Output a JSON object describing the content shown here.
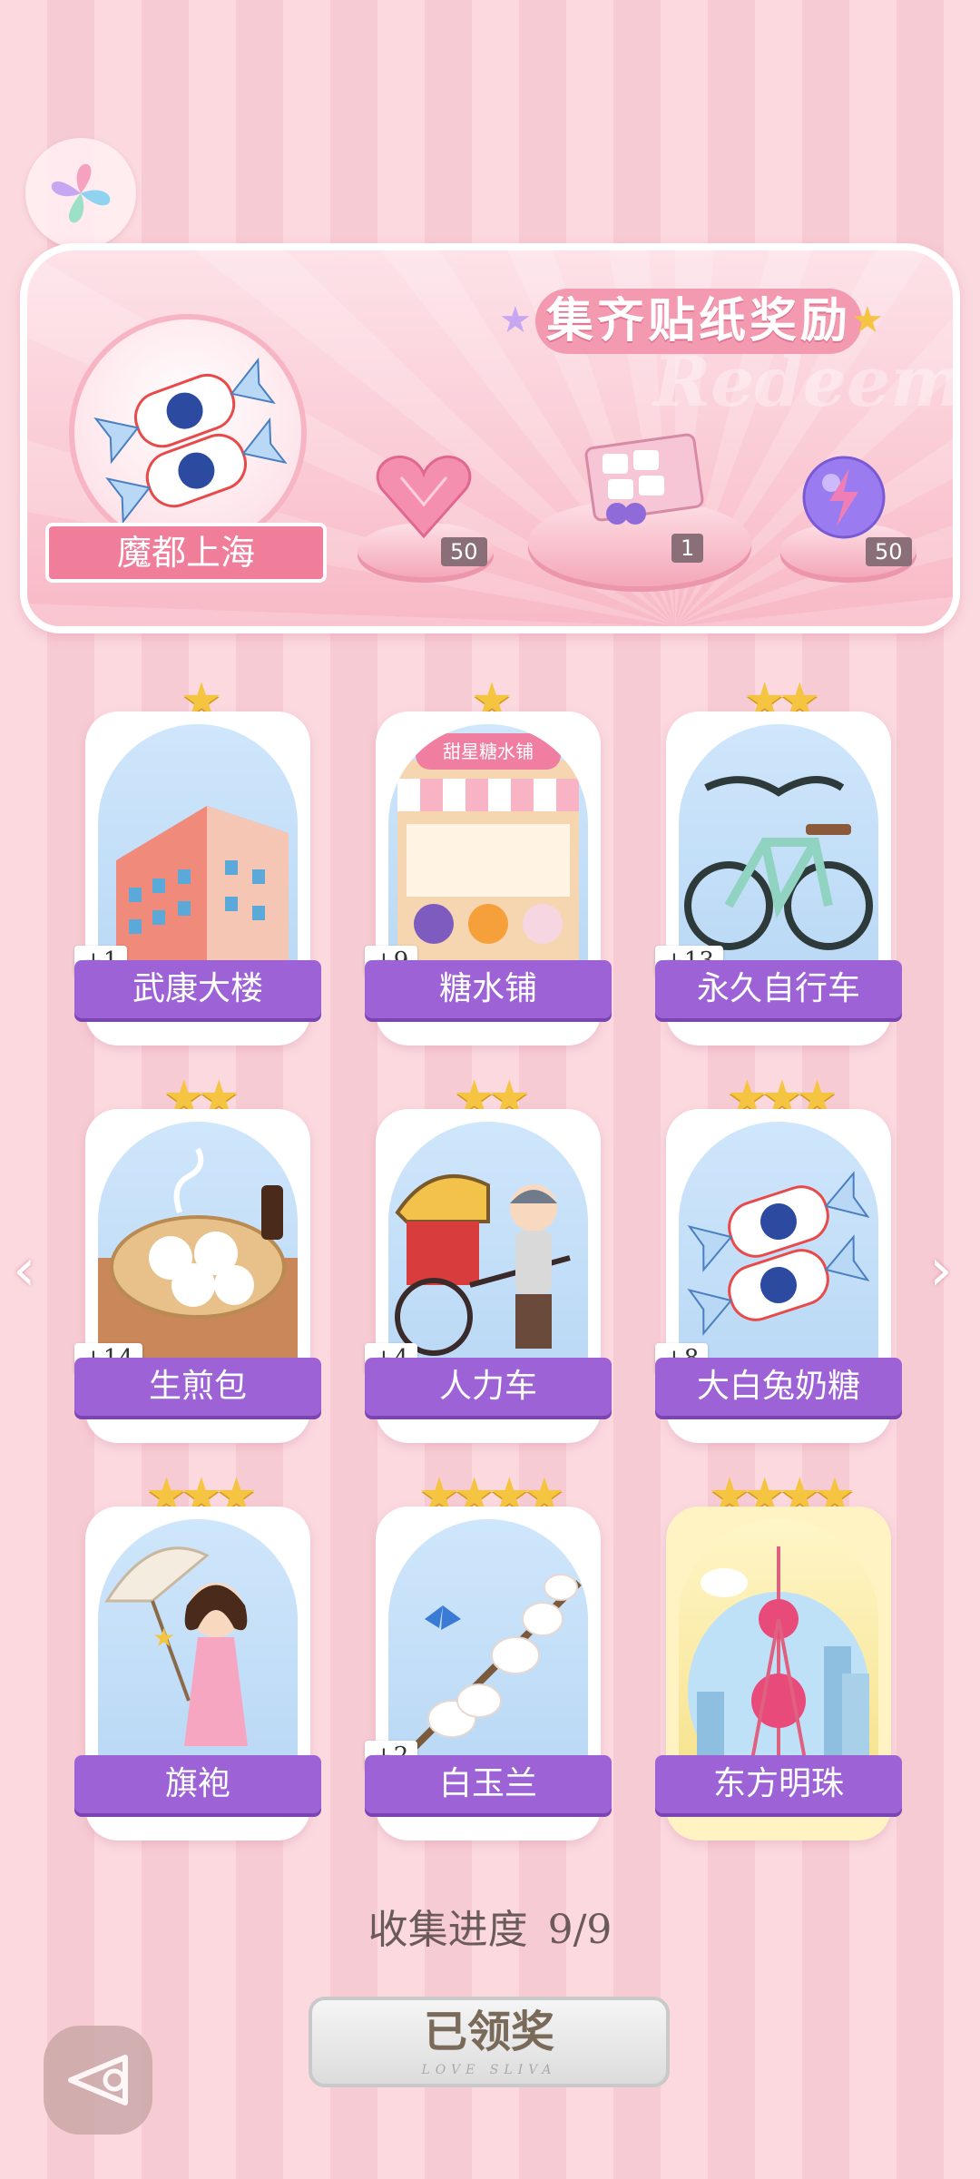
{
  "header": {
    "logo_icon": "pinwheel-logo-icon"
  },
  "banner": {
    "title": "集齐贴纸奖励",
    "bg_word": "Redeem",
    "location": "魔都上海",
    "rewards": [
      {
        "icon": "heart-diamond-icon",
        "count": "50"
      },
      {
        "icon": "gift-box-icon",
        "count": "1"
      },
      {
        "icon": "energy-orb-icon",
        "count": "50"
      }
    ]
  },
  "cards": [
    {
      "name": "武康大楼",
      "stars": "★",
      "plus": "+1",
      "icon": "building-icon"
    },
    {
      "name": "糖水铺",
      "stars": "★",
      "plus": "+9",
      "icon": "dessert-shop-icon",
      "shop_sign": "甜星糖水铺"
    },
    {
      "name": "永久自行车",
      "stars": "★★",
      "plus": "+13",
      "icon": "bicycle-icon"
    },
    {
      "name": "生煎包",
      "stars": "★★",
      "plus": "+14",
      "icon": "dumpling-icon"
    },
    {
      "name": "人力车",
      "stars": "★★",
      "plus": "+4",
      "icon": "rickshaw-icon"
    },
    {
      "name": "大白兔奶糖",
      "stars": "★★★",
      "plus": "+8",
      "icon": "candy-icon"
    },
    {
      "name": "旗袍",
      "stars": "★★★",
      "plus": "",
      "icon": "qipao-girl-icon"
    },
    {
      "name": "白玉兰",
      "stars": "★★★★",
      "plus": "+2",
      "icon": "magnolia-icon"
    },
    {
      "name": "东方明珠",
      "stars": "★★★★",
      "plus": "",
      "icon": "oriental-pearl-tower-icon"
    }
  ],
  "nav": {
    "left": "‹",
    "right": "›"
  },
  "progress": {
    "label": "收集进度",
    "value": "9/9"
  },
  "claim_button": {
    "label": "已领奖",
    "sub": "LOVE SLIVA"
  },
  "back_button": {
    "icon": "back-arrow-icon"
  },
  "colors": {
    "card_label": "#9d63d6",
    "banner_pink": "#f39ab0",
    "star": "#f5c542"
  }
}
